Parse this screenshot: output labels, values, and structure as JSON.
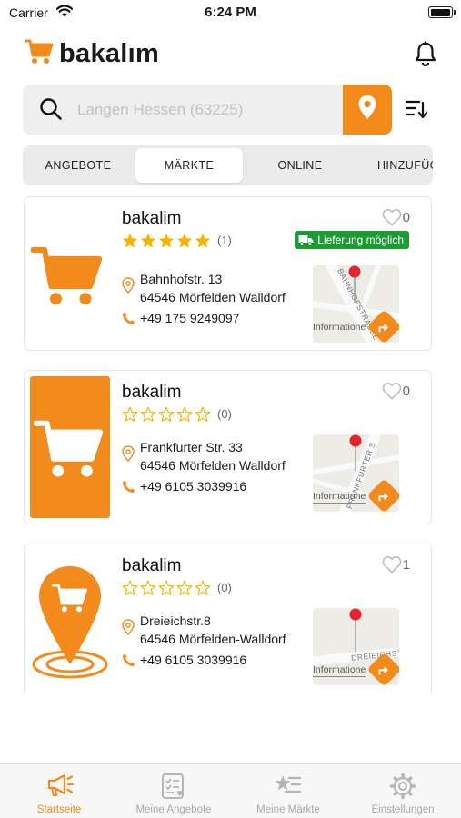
{
  "colors": {
    "accent": "#f28a1c",
    "delivery": "#1e9a33",
    "star": "#f5b400",
    "inactive": "#a9a9a9"
  },
  "status_bar": {
    "carrier": "Carrier",
    "time": "6:24 PM"
  },
  "header": {
    "logo_text": "bakalım",
    "logo_icon": "cart-icon",
    "bell_icon": "bell-icon"
  },
  "search": {
    "value": "",
    "placeholder": "Langen Hessen (63225)"
  },
  "tabs": [
    {
      "label": "ANGEBOTE",
      "active": false
    },
    {
      "label": "MÄRKTE",
      "active": true
    },
    {
      "label": "ONLINE",
      "active": false
    },
    {
      "label": "HINZUFÜG",
      "active": false
    }
  ],
  "stores": [
    {
      "name": "bakalim",
      "rating": 5,
      "rating_count": "(1)",
      "favorites": "0",
      "delivery": "Lieferung möglich",
      "street": "Bahnhofstr. 13",
      "city": "64546 Mörfelden Walldorf",
      "phone": "+49 175 9249097",
      "map_street": "BAHNHOFSTRASSE",
      "map_info": "Informatione"
    },
    {
      "name": "bakalim",
      "rating": 0,
      "rating_count": "(0)",
      "favorites": "0",
      "street": "Frankfurter Str. 33",
      "city": "64546 Mörfelden Walldorf",
      "phone": "+49 6105 3039916",
      "map_street": "FRANKFURTER S",
      "map_info": "Informatione"
    },
    {
      "name": "bakalim",
      "rating": 0,
      "rating_count": "(0)",
      "favorites": "1",
      "street": "Dreieichstr.8",
      "city": "64546 Mörfelden-Walldorf",
      "phone": "+49 6105 3039916",
      "map_street": "DREIEICHSTRAS",
      "map_info": "Informatione"
    }
  ],
  "tabbar": [
    {
      "label": "Startseite",
      "icon": "megaphone-icon",
      "active": true
    },
    {
      "label": "Meine Angebote",
      "icon": "checklist-icon",
      "active": false
    },
    {
      "label": "Meine Märkte",
      "icon": "star-list-icon",
      "active": false
    },
    {
      "label": "Einstellungen",
      "icon": "gear-icon",
      "active": false
    }
  ]
}
